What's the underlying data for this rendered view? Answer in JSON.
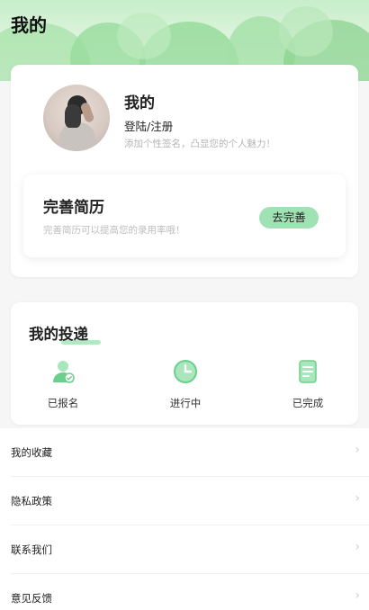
{
  "header": {
    "title": "我的"
  },
  "profile": {
    "name": "我的",
    "login_link": "登陆/注册",
    "signature": "添加个性签名，凸显您的个人魅力！"
  },
  "resume": {
    "title": "完善简历",
    "subtitle": "完善简历可以提高您的录用率哦！",
    "button_label": "去完善"
  },
  "delivery": {
    "title": "我的投递",
    "items": [
      {
        "label": "已报名",
        "icon": "user-check-icon"
      },
      {
        "label": "进行中",
        "icon": "clock-icon"
      },
      {
        "label": "已完成",
        "icon": "document-icon"
      }
    ]
  },
  "menu": [
    {
      "label": "我的收藏"
    },
    {
      "label": "隐私政策"
    },
    {
      "label": "联系我们"
    },
    {
      "label": "意见反馈"
    }
  ],
  "colors": {
    "accent_green": "#9fe3b4",
    "icon_green": "#6ccf8d",
    "header_green": "#c7eec9"
  }
}
